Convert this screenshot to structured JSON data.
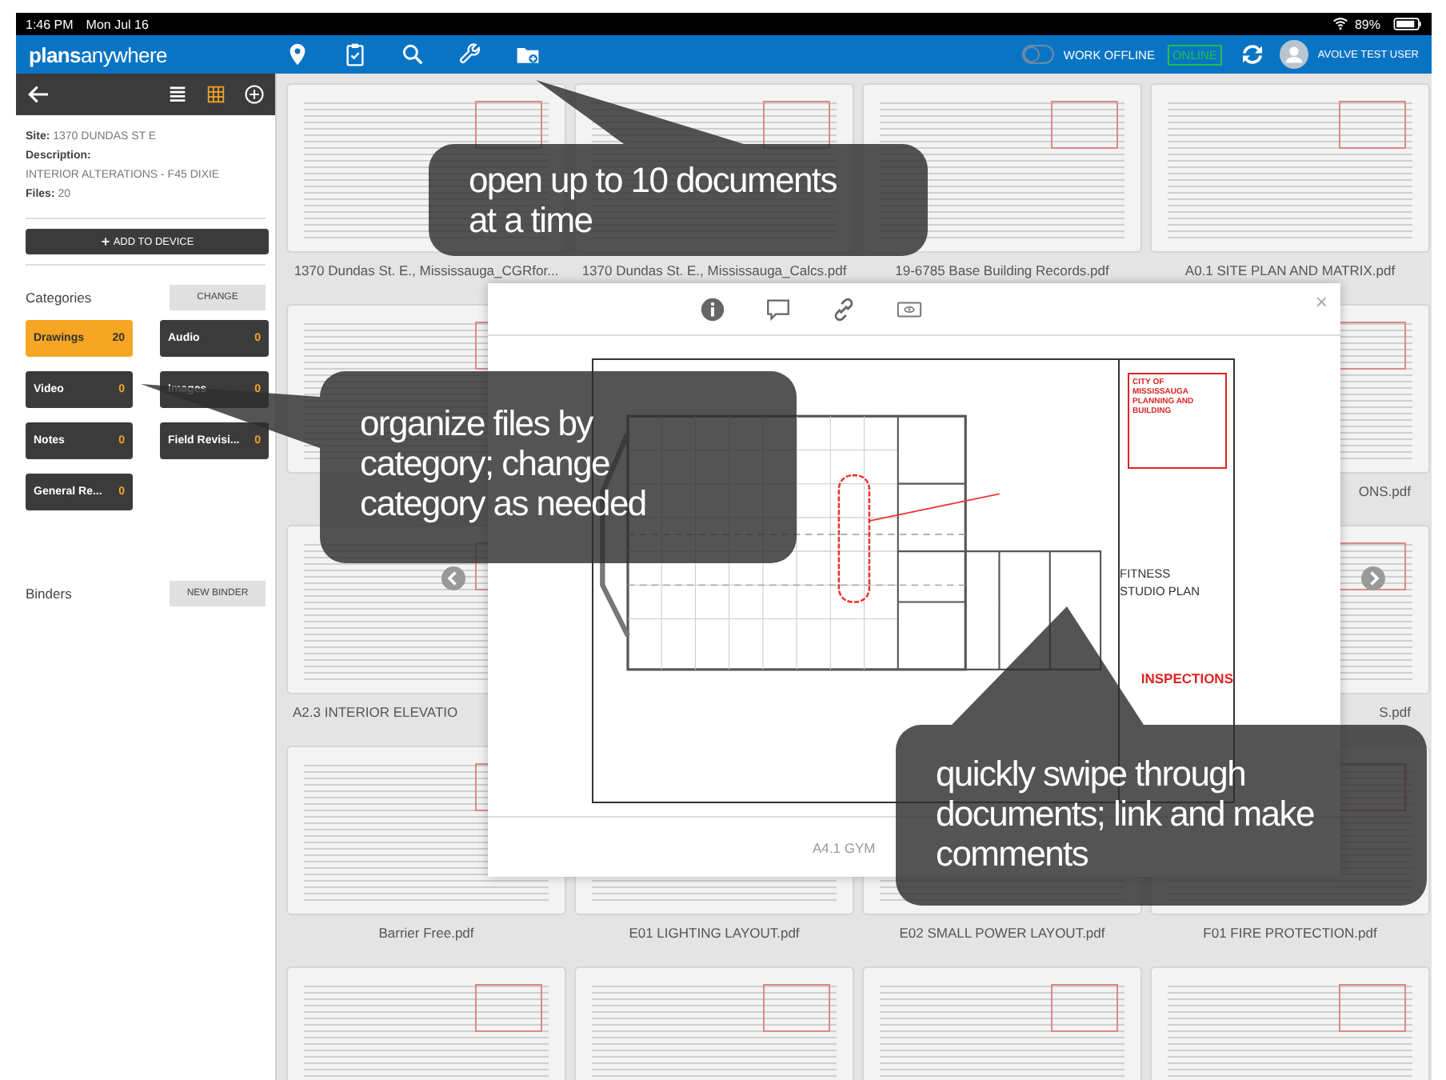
{
  "status_bar": {
    "time": "1:46 PM",
    "date": "Mon Jul 16",
    "battery": "89%"
  },
  "header": {
    "logo": "**plans**anywhere",
    "tools": [
      {
        "kind": "pin"
      },
      {
        "kind": "clipboard"
      },
      {
        "kind": "search"
      },
      {
        "kind": "wrench"
      },
      {
        "kind": "folder"
      }
    ],
    "work_offline": {
      "label": "WORK OFFLINE",
      "on": false
    },
    "connection": "ONLINE",
    "user": "AVOLVE TEST USER"
  },
  "sidebar": {
    "views": [
      {
        "kind": "list",
        "selected": false
      },
      {
        "kind": "grid",
        "selected": true
      }
    ],
    "site_label": "Site:",
    "site": "1370 DUNDAS ST E",
    "description_label": "Description:",
    "description": "INTERIOR ALTERATIONS - F45 DIXIE",
    "files_label": "Files:",
    "files": "20",
    "add_button": "ADD TO DEVICE",
    "categories_title": "Categories",
    "change_button": "CHANGE",
    "categories": [
      {
        "name": "Drawings",
        "count": "20",
        "selected": true
      },
      {
        "name": "Audio",
        "count": "0",
        "selected": false
      },
      {
        "name": "Video",
        "count": "0",
        "selected": false
      },
      {
        "name": "Images",
        "count": "0",
        "selected": false
      },
      {
        "name": "Notes",
        "count": "0",
        "selected": false
      },
      {
        "name": "Field Revisi...",
        "count": "0",
        "selected": false
      },
      {
        "name": "General Re...",
        "count": "0",
        "selected": false
      }
    ],
    "binders_title": "Binders",
    "new_binder_button": "NEW BINDER"
  },
  "files": [
    {
      "kind": "centered",
      "name": "1370 Dundas St. E., Mississauga_CGRfor..."
    },
    {
      "kind": "centered",
      "name": "1370 Dundas St. E., Mississauga_Calcs.pdf"
    },
    {
      "kind": "centered",
      "name": "19-6785 Base Building Records.pdf"
    },
    {
      "kind": "centered",
      "name": "A0.1 SITE PLAN AND MATRIX.pdf"
    },
    {
      "kind": "hidden"
    },
    {
      "kind": "hidden"
    },
    {
      "kind": "hidden"
    },
    {
      "kind": "tail",
      "name": "ONS.pdf"
    },
    {
      "kind": "head",
      "name": "A2.3 INTERIOR ELEVATIO"
    },
    {
      "kind": "hidden"
    },
    {
      "kind": "hidden"
    },
    {
      "kind": "tail",
      "name": "S.pdf"
    },
    {
      "kind": "centered",
      "name": "Barrier Free.pdf"
    },
    {
      "kind": "centered",
      "name": "E01 LIGHTING LAYOUT.pdf"
    },
    {
      "kind": "centered",
      "name": "E02 SMALL POWER LAYOUT.pdf"
    },
    {
      "kind": "centered",
      "name": "F01 FIRE PROTECTION.pdf"
    },
    {
      "kind": "hidden"
    },
    {
      "kind": "hidden"
    },
    {
      "kind": "hidden"
    },
    {
      "kind": "hidden"
    }
  ],
  "viewer": {
    "tools": [
      {
        "kind": "info"
      },
      {
        "kind": "comment"
      },
      {
        "kind": "link"
      },
      {
        "kind": "eye"
      }
    ],
    "close": "×",
    "stamp": "CITY OF MISSISSAUGA PLANNING AND BUILDING",
    "sheet_title": "FITNESS STUDIO PLAN",
    "inspection": "INSPECTIONS",
    "caption": "A4.1 GYM"
  },
  "callouts": [
    {
      "text": "open up to 10 documents at a time"
    },
    {
      "text": "organize files by category; change category as needed"
    },
    {
      "text": "quickly swipe through documents; link and make comments"
    }
  ]
}
